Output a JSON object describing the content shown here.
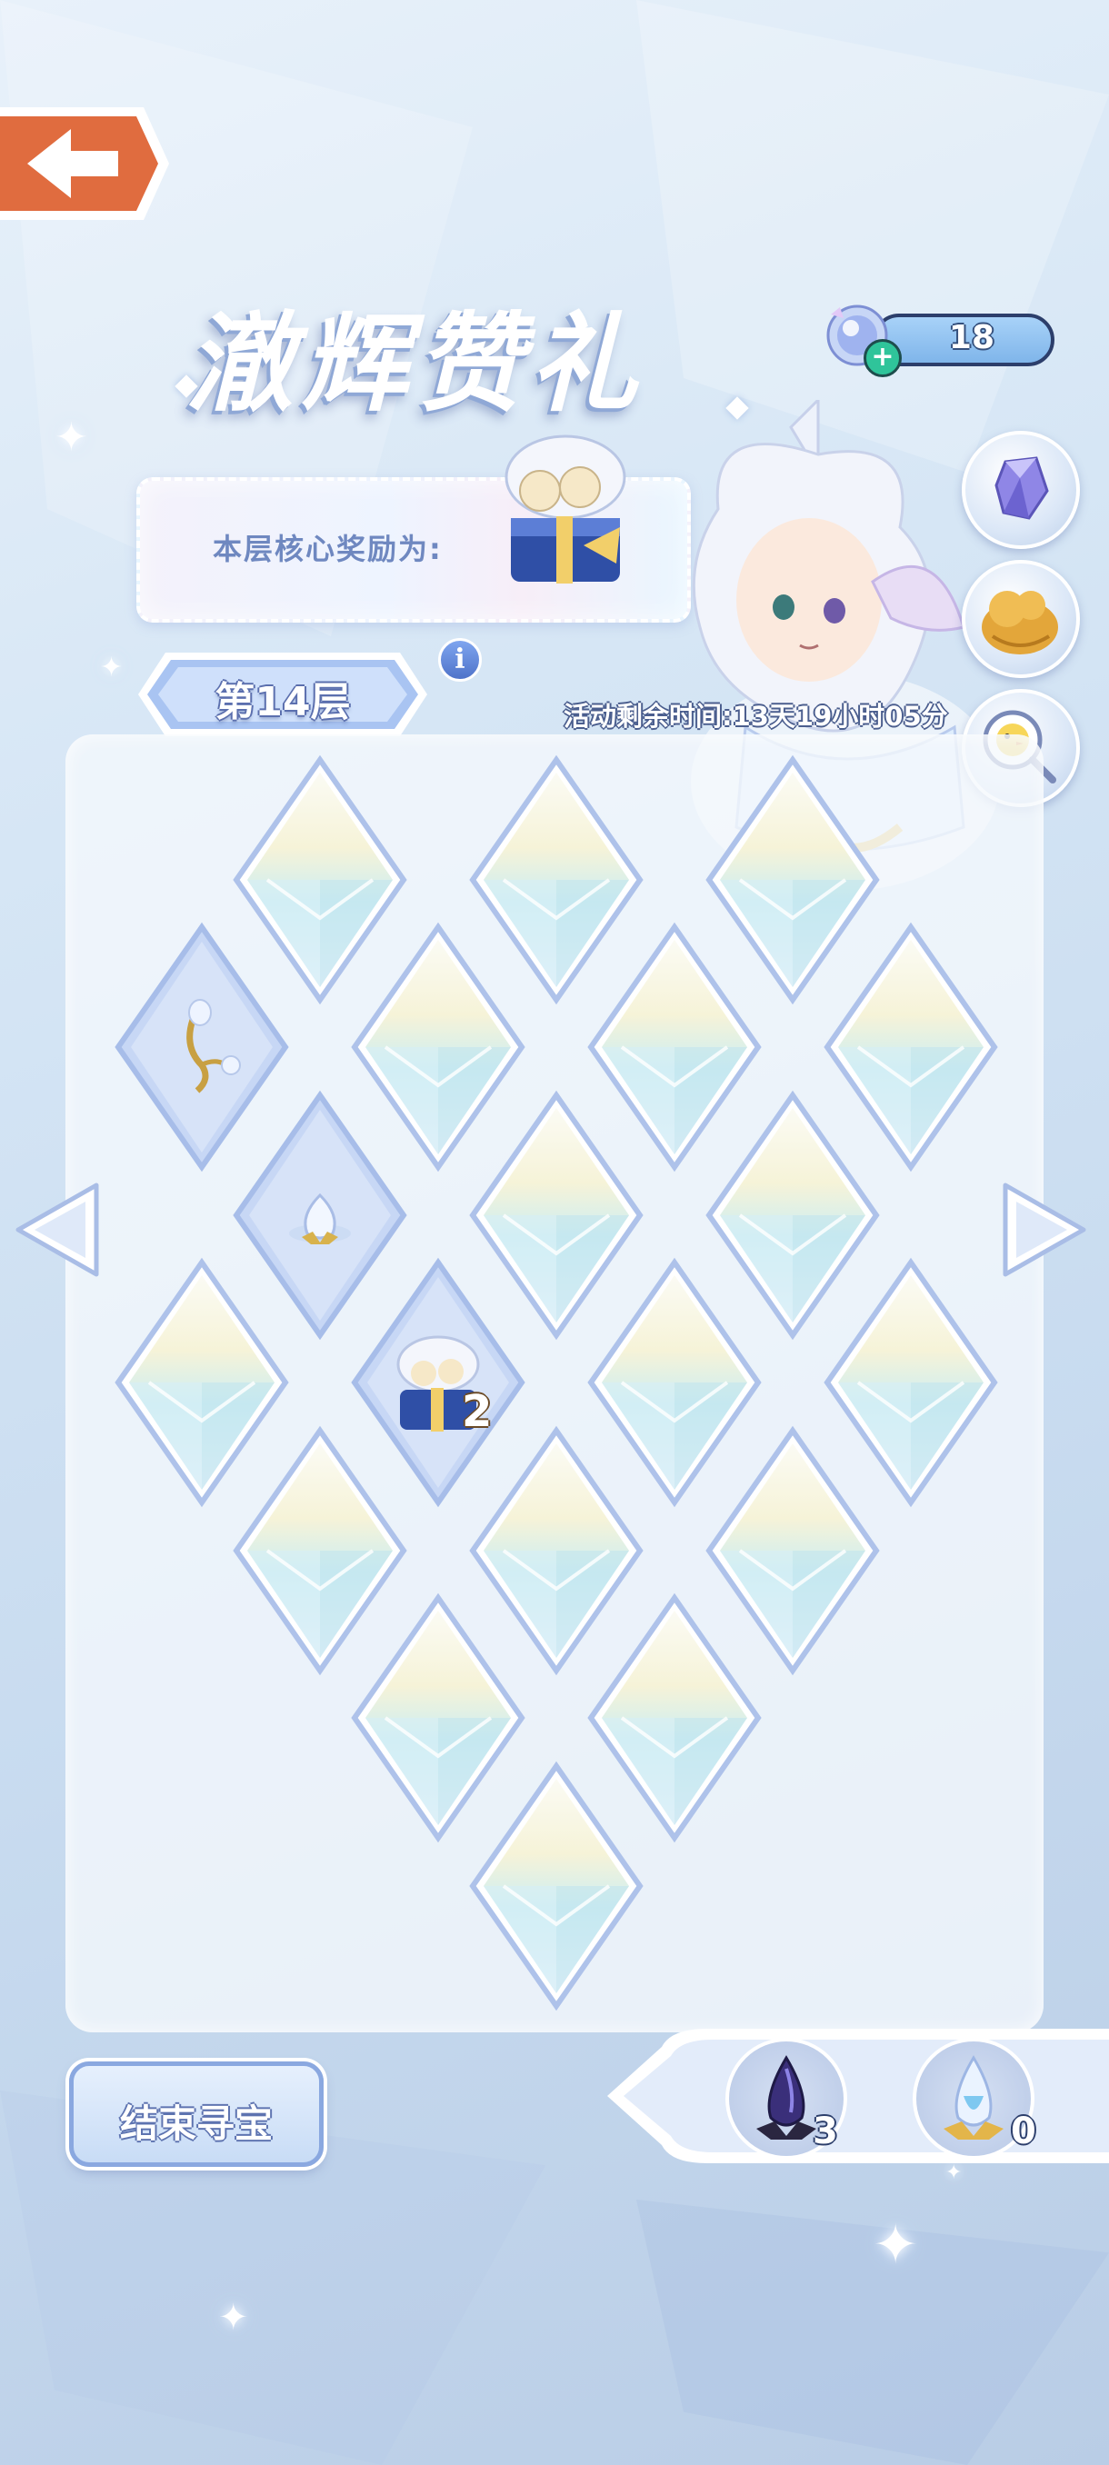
{
  "title": "澈辉赞礼",
  "currency": {
    "value": "18",
    "icon": "crystal-orb-icon"
  },
  "reward": {
    "label": "本层核心奖励为:",
    "item_icon": "gift-box-icon"
  },
  "floor": {
    "label": "第14层"
  },
  "info": {
    "icon": "info-icon",
    "glyph": "i"
  },
  "event": {
    "time_remaining": "活动剩余时间:13天19小时05分"
  },
  "side_buttons": [
    {
      "name": "crystal-shop-icon"
    },
    {
      "name": "golden-lion-icon"
    },
    {
      "name": "magnifier-chick-icon"
    }
  ],
  "board": {
    "revealed": [
      {
        "item": "golden-flower-branch-icon"
      },
      {
        "item": "crystal-seed-icon"
      },
      {
        "item": "gift-box-icon",
        "count": "2"
      }
    ]
  },
  "end_button": {
    "label": "结束寻宝"
  },
  "inventory": [
    {
      "icon": "dark-crystal-icon",
      "count": "3"
    },
    {
      "icon": "light-crystal-icon",
      "count": "0"
    }
  ],
  "colors": {
    "accent": "#7f9bd8",
    "background": "#d6e6f5",
    "tile_border": "#9fb6e6"
  }
}
